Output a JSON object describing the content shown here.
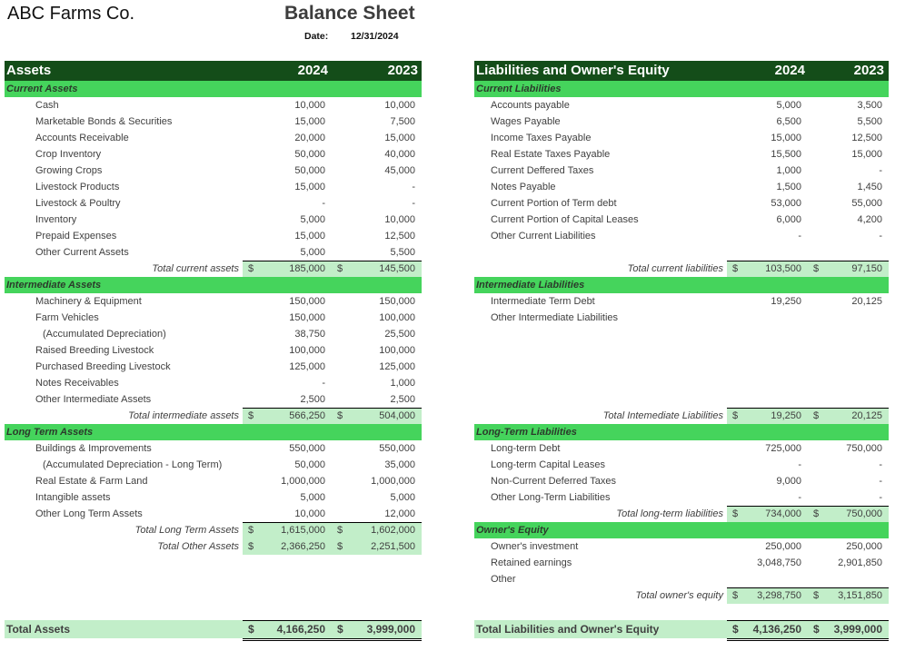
{
  "header": {
    "company": "ABC Farms Co.",
    "title": "Balance Sheet",
    "date_label": "Date:",
    "date_value": "12/31/2024"
  },
  "assets": {
    "heading": "Assets",
    "year1": "2024",
    "year2": "2023",
    "current": {
      "title": "Current Assets",
      "items": [
        {
          "label": "Cash",
          "y2024": "10,000",
          "y2023": "10,000"
        },
        {
          "label": "Marketable Bonds & Securities",
          "y2024": "15,000",
          "y2023": "7,500"
        },
        {
          "label": "Accounts Receivable",
          "y2024": "20,000",
          "y2023": "15,000"
        },
        {
          "label": "Crop Inventory",
          "y2024": "50,000",
          "y2023": "40,000"
        },
        {
          "label": "Growing Crops",
          "y2024": "50,000",
          "y2023": "45,000"
        },
        {
          "label": "Livestock Products",
          "y2024": "15,000",
          "y2023": "-"
        },
        {
          "label": "Livestock & Poultry",
          "y2024": "-",
          "y2023": "-"
        },
        {
          "label": "Inventory",
          "y2024": "5,000",
          "y2023": "10,000"
        },
        {
          "label": "Prepaid Expenses",
          "y2024": "15,000",
          "y2023": "12,500"
        },
        {
          "label": "Other Current Assets",
          "y2024": "5,000",
          "y2023": "5,500"
        }
      ],
      "total": {
        "label": "Total current assets",
        "y2024": "185,000",
        "y2023": "145,500"
      }
    },
    "intermediate": {
      "title": "Intermediate Assets",
      "items": [
        {
          "label": "Machinery & Equipment",
          "y2024": "150,000",
          "y2023": "150,000"
        },
        {
          "label": "Farm Vehicles",
          "y2024": "150,000",
          "y2023": "100,000"
        },
        {
          "label": "(Accumulated Depreciation)",
          "y2024": "38,750",
          "y2023": "25,500"
        },
        {
          "label": "Raised Breeding Livestock",
          "y2024": "100,000",
          "y2023": "100,000"
        },
        {
          "label": "Purchased Breeding Livestock",
          "y2024": "125,000",
          "y2023": "125,000"
        },
        {
          "label": "Notes Receivables",
          "y2024": "-",
          "y2023": "1,000"
        },
        {
          "label": "Other Intermediate Assets",
          "y2024": "2,500",
          "y2023": "2,500"
        }
      ],
      "total": {
        "label": "Total intermediate assets",
        "y2024": "566,250",
        "y2023": "504,000"
      }
    },
    "longterm": {
      "title": "Long Term Assets",
      "items": [
        {
          "label": "Buildings & Improvements",
          "y2024": "550,000",
          "y2023": "550,000"
        },
        {
          "label": "(Accumulated Depreciation - Long Term)",
          "y2024": "50,000",
          "y2023": "35,000"
        },
        {
          "label": "Real Estate & Farm Land",
          "y2024": "1,000,000",
          "y2023": "1,000,000"
        },
        {
          "label": "Intangible assets",
          "y2024": "5,000",
          "y2023": "5,000"
        },
        {
          "label": "Other Long Term Assets",
          "y2024": "10,000",
          "y2023": "12,000"
        }
      ],
      "total": {
        "label": "Total Long Term Assets",
        "y2024": "1,615,000",
        "y2023": "1,602,000"
      },
      "total_other": {
        "label": "Total Other Assets",
        "y2024": "2,366,250",
        "y2023": "2,251,500"
      }
    },
    "grand_total": {
      "label": "Total Assets",
      "y2024": "4,166,250",
      "y2023": "3,999,000"
    }
  },
  "liabilities": {
    "heading": "Liabilities and Owner's Equity",
    "year1": "2024",
    "year2": "2023",
    "current": {
      "title": "Current Liabilities",
      "items": [
        {
          "label": "Accounts payable",
          "y2024": "5,000",
          "y2023": "3,500"
        },
        {
          "label": "Wages Payable",
          "y2024": "6,500",
          "y2023": "5,500"
        },
        {
          "label": "Income Taxes Payable",
          "y2024": "15,000",
          "y2023": "12,500"
        },
        {
          "label": "Real Estate Taxes Payable",
          "y2024": "15,500",
          "y2023": "15,000"
        },
        {
          "label": "Current Deffered Taxes",
          "y2024": "1,000",
          "y2023": "-"
        },
        {
          "label": "Notes Payable",
          "y2024": "1,500",
          "y2023": "1,450"
        },
        {
          "label": "Current Portion of Term debt",
          "y2024": "53,000",
          "y2023": "55,000"
        },
        {
          "label": "Current Portion of Capital Leases",
          "y2024": "6,000",
          "y2023": "4,200"
        },
        {
          "label": "Other Current Liabilities",
          "y2024": "-",
          "y2023": "-"
        }
      ],
      "total": {
        "label": "Total current liabilities",
        "y2024": "103,500",
        "y2023": "97,150"
      }
    },
    "intermediate": {
      "title": "Intermediate Liabilities",
      "items": [
        {
          "label": "Intermediate Term Debt",
          "y2024": "19,250",
          "y2023": "20,125"
        },
        {
          "label": "Other Intermediate Liabilities",
          "y2024": "",
          "y2023": ""
        }
      ],
      "total": {
        "label": "Total Intemediate Liabilities",
        "y2024": "19,250",
        "y2023": "20,125"
      }
    },
    "longterm": {
      "title": "Long-Term Liabilities",
      "items": [
        {
          "label": "Long-term Debt",
          "y2024": "725,000",
          "y2023": "750,000"
        },
        {
          "label": "Long-term Capital Leases",
          "y2024": "-",
          "y2023": "-"
        },
        {
          "label": "Non-Current Deferred Taxes",
          "y2024": "9,000",
          "y2023": "-"
        },
        {
          "label": "Other Long-Term  Liabilities",
          "y2024": "-",
          "y2023": "-"
        }
      ],
      "total": {
        "label": "Total long-term liabilities",
        "y2024": "734,000",
        "y2023": "750,000"
      }
    },
    "equity": {
      "title": "Owner's Equity",
      "items": [
        {
          "label": "Owner's investment",
          "y2024": "250,000",
          "y2023": "250,000"
        },
        {
          "label": "Retained earnings",
          "y2024": "3,048,750",
          "y2023": "2,901,850"
        },
        {
          "label": "Other",
          "y2024": "",
          "y2023": ""
        }
      ],
      "total": {
        "label": "Total owner's equity",
        "y2024": "3,298,750",
        "y2023": "3,151,850"
      }
    },
    "grand_total": {
      "label": "Total Liabilities and Owner's Equity",
      "y2024": "4,136,250",
      "y2023": "3,999,000"
    }
  },
  "currency_symbol": "$"
}
